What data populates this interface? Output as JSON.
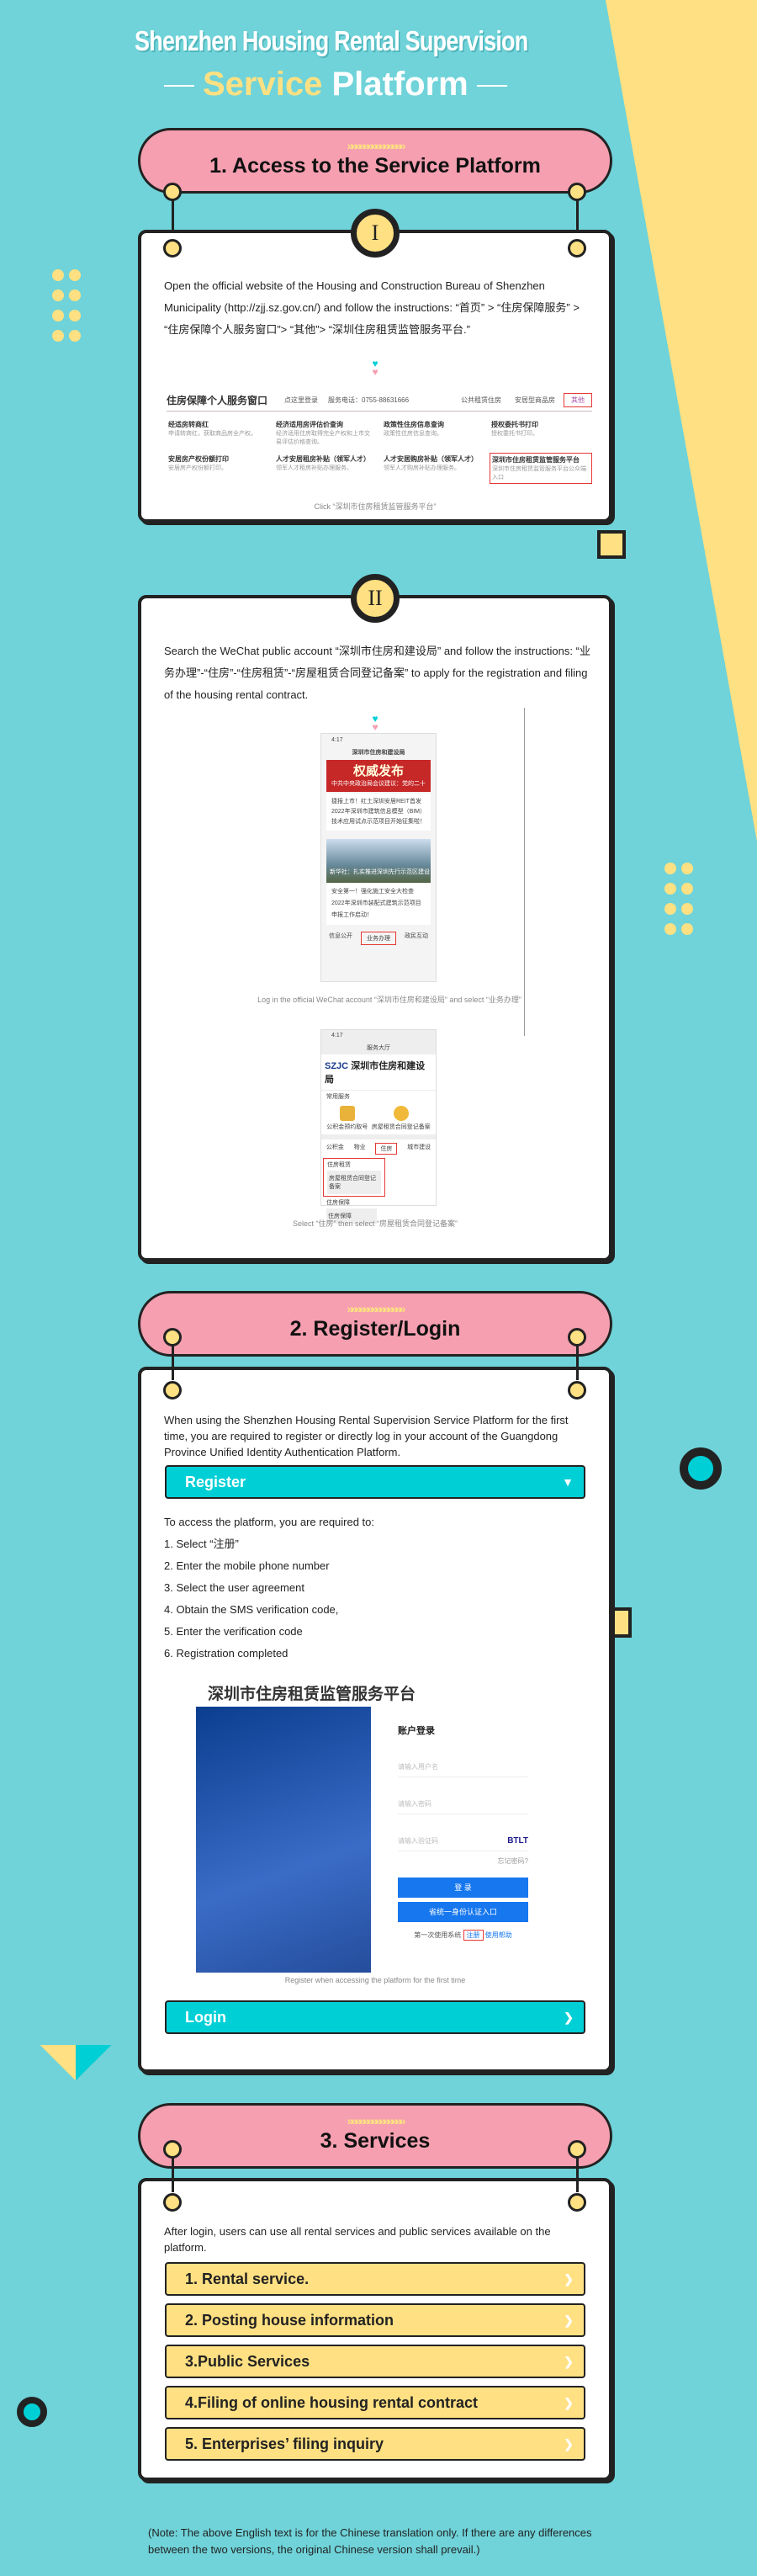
{
  "header": {
    "title_line1": "Shenzhen Housing Rental Supervision",
    "title_line2_a": "Service",
    "title_line2_b": "Platform"
  },
  "colors": {
    "background": "#6fd3d9",
    "banner": "#f59fb0",
    "accent_yellow": "#ffe082",
    "accent_cyan": "#00cfd6"
  },
  "section1": {
    "title": "1. Access to the Service Platform",
    "chevrons": "»»»»»»»»»»»»»»",
    "step_numeral": "I",
    "text": "Open the official website of the Housing and Construction Bureau of Shenzhen Municipality (http://zjj.sz.gov.cn/) and follow the instructions: “首页” > “住房保障服务” > “住房保障个人服务窗口”> “其他”> “深圳住房租赁监管服务平台.”",
    "screenshot": {
      "title": "住房保障个人服务窗口",
      "login": "点这里登录",
      "phone": "服务电话：0755-88631666",
      "tabs": [
        "公共租赁住房",
        "安居型商品房",
        "其他"
      ],
      "items": [
        {
          "name": "经适房转商红",
          "desc": "申请转商红，获取商品房全产权。"
        },
        {
          "name": "经济适用房评估价查询",
          "desc": "经济适用住房取得完全产权和上市交易评估价格查询。"
        },
        {
          "name": "政策性住房信息查询",
          "desc": "政策性住房信息查询。"
        },
        {
          "name": "授权委托书打印",
          "desc": "授权委托书打印。"
        },
        {
          "name": "安居房产权份额打印",
          "desc": "安居房产权份额打印。"
        },
        {
          "name": "人才安居租房补贴（领军人才）",
          "desc": "领军人才租房补贴办理服务。"
        },
        {
          "name": "人才安居购房补贴（领军人才）",
          "desc": "领军人才购房补贴办理服务。"
        },
        {
          "name": "深圳市住房租赁监管服务平台",
          "desc": "深圳市住房租赁监管服务平台公众端入口"
        }
      ]
    },
    "caption": "Click “深圳市住房租赁监管服务平台”"
  },
  "section1b": {
    "step_numeral": "II",
    "text": "Search the WeChat public account “深圳市住房和建设局” and follow the instructions: “业务办理”-“住房”-“住房租赁”-“房屋租赁合同登记备案” to apply for the registration and filing of the housing rental contract.",
    "phone1": {
      "time": "4:17",
      "account": "深圳市住房和建设局",
      "headline": "权威发布",
      "news": [
        "中共中央政治局会议建议：党的二十大于10月16日在京召开",
        "捷报上市！红土深圳安居REIT首发",
        "2022年深圳市建筑信息模型（BIM）技术应用试点示范项目开始征集啦！",
        "新华社：扎实推进深圳先行示范区建设",
        "安全第一！强化施工安全大检查",
        "2022年深圳市装配式建筑示范项目申报工作启动！"
      ],
      "menu": [
        "信息公开",
        "业务办理",
        "政民互动"
      ]
    },
    "caption1": "Log in the official WeChat account “深圳市住房和建设局” and select “业务办理”",
    "phone2": {
      "time": "4:17",
      "nav": "服务大厅",
      "org": "深圳市住房和建设局",
      "common": "常用服务",
      "services": [
        "公积金预约取号",
        "房屋租赁合同登记备案"
      ],
      "tabs": [
        "公积金",
        "物业",
        "住房",
        "城市建设"
      ],
      "group1": "住房租赁",
      "item1": "房屋租赁合同登记备案",
      "group2": "住房保障",
      "item2": "住房保障"
    },
    "caption2": "Select “住房” then select “房屋租赁合同登记备案”"
  },
  "section2": {
    "title": "2. Register/Login",
    "chevrons": "»»»»»»»»»»»»»»",
    "intro": "When using the Shenzhen Housing Rental Supervision Service Platform for the first time, you are required to register or directly log in your account of the Guangdong Province Unified Identity Authentication Platform.",
    "register_label": "Register",
    "steps_intro": "To access the platform, you are required to:",
    "steps": [
      "1. Select “注册”",
      "2. Enter the mobile phone number",
      "3. Select the user agreement",
      "4. Obtain the SMS verification code,",
      "5. Enter the verification code",
      "6. Registration completed"
    ],
    "login_screenshot": {
      "platform_title": "深圳市住房租赁监管服务平台",
      "panel_title": "账户登录",
      "username_placeholder": "请输入用户名",
      "password_placeholder": "请输入密码",
      "captcha_placeholder": "请输入验证码",
      "captcha": "BTLT",
      "forgot": "忘记密码?",
      "login_btn": "登 录",
      "unified_btn": "省统一身份认证入口",
      "first_time": "第一次使用系统",
      "register_link": "注册",
      "help_link": "使用帮助"
    },
    "caption": "Register when accessing the platform for the first time",
    "login_label": "Login"
  },
  "section3": {
    "title": "3. Services",
    "chevrons": "»»»»»»»»»»»»»»",
    "intro": "After login, users can use all rental services and public services available on the platform.",
    "items": [
      "1. Rental service.",
      "2. Posting house information",
      "3.Public Services",
      "4.Filing of online housing rental contract",
      "5. Enterprises’ filing inquiry"
    ]
  },
  "note": "(Note: The above English text is for the Chinese translation only. If there are any differences between the two versions, the original Chinese version shall prevail.)"
}
